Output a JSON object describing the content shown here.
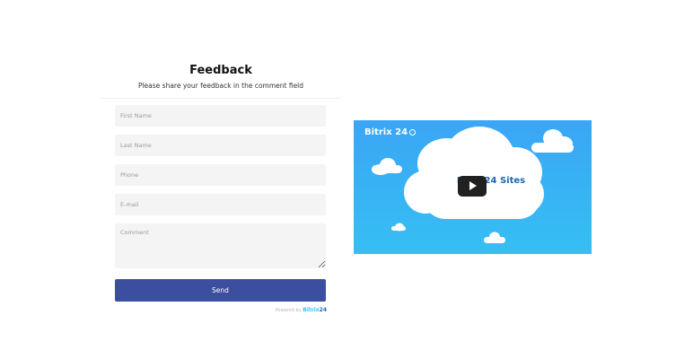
{
  "form": {
    "title": "Feedback",
    "subtitle": "Please share your feedback in the comment field",
    "fields": [
      {
        "placeholder": "First Name",
        "value": ""
      },
      {
        "placeholder": "Last Name",
        "value": ""
      },
      {
        "placeholder": "Phone",
        "value": ""
      },
      {
        "placeholder": "E-mail",
        "value": ""
      },
      {
        "placeholder": "Comment",
        "value": ""
      }
    ],
    "send_label": "Send",
    "powered_by": "Powered by",
    "powered_brand": "Bitrix",
    "powered_brand_num": "24"
  },
  "video": {
    "logo_text": "Bitrix 24",
    "center_text": "Bitrix24 Sites",
    "play_icon": "play-icon",
    "colors": {
      "sky_top": "#3aa5f5",
      "sky_bottom": "#36bff3",
      "cloud": "#ffffff",
      "play": "#212121"
    }
  },
  "colors": {
    "send_button": "#3c4e9f",
    "field_bg": "#f4f4f4",
    "brand_blue": "#2fc6f6"
  }
}
